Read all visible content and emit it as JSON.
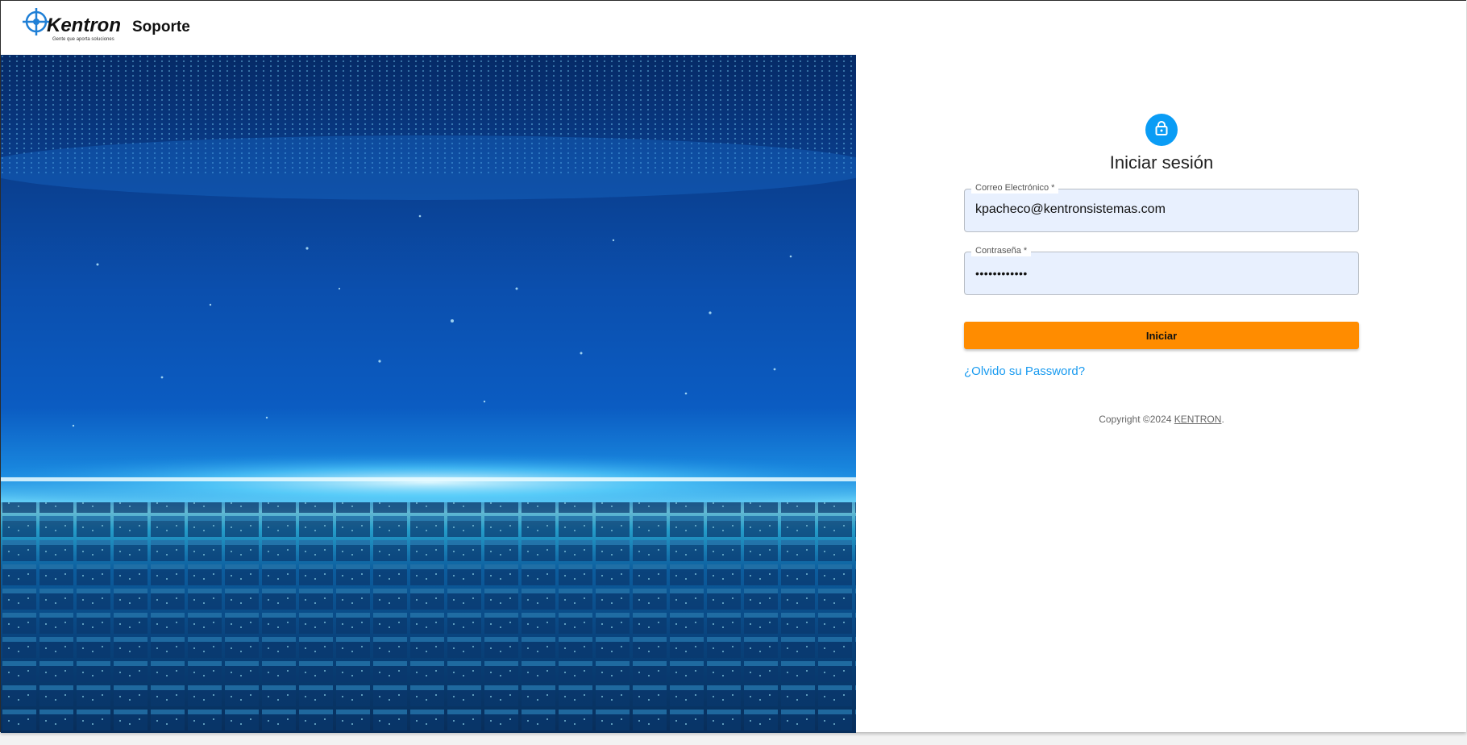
{
  "header": {
    "brand": "Kentron",
    "tagline": "Gente que aporta soluciones",
    "title": "Soporte"
  },
  "login": {
    "title": "Iniciar sesión",
    "email": {
      "label": "Correo Electrónico *",
      "value": "kpacheco@kentronsistemas.com"
    },
    "password": {
      "label": "Contraseña *",
      "value": "••••••••••••"
    },
    "submit_label": "Iniciar",
    "forgot_label": "¿Olvido su Password?",
    "copyright_prefix": "Copyright ©2024 ",
    "copyright_link": "KENTRON",
    "copyright_suffix": "."
  },
  "colors": {
    "accent": "#ff8c00",
    "link": "#1a9bf0",
    "avatar": "#0a9cf5",
    "field_bg": "#e8f0fe"
  },
  "icons": {
    "avatar": "lock-icon",
    "logo": "crosshair-globe-icon"
  }
}
